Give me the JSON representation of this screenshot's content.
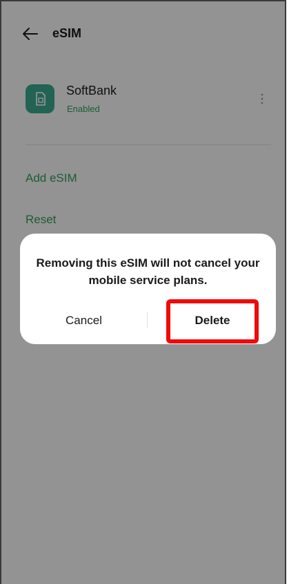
{
  "header": {
    "back_icon": "arrow-left-icon",
    "title": "eSIM"
  },
  "sim_entry": {
    "icon": "sim-card-icon",
    "name": "SoftBank",
    "status": "Enabled",
    "menu_icon": "more-vertical-icon"
  },
  "actions": {
    "add_esim": "Add eSIM",
    "reset": "Reset"
  },
  "dialog": {
    "message": "Removing this eSIM will not cancel your mobile service plans.",
    "cancel_label": "Cancel",
    "delete_label": "Delete"
  },
  "colors": {
    "accent_green": "#2e9a58",
    "sim_icon_bg": "#3aa58d",
    "highlight_red": "#f00a0a"
  }
}
